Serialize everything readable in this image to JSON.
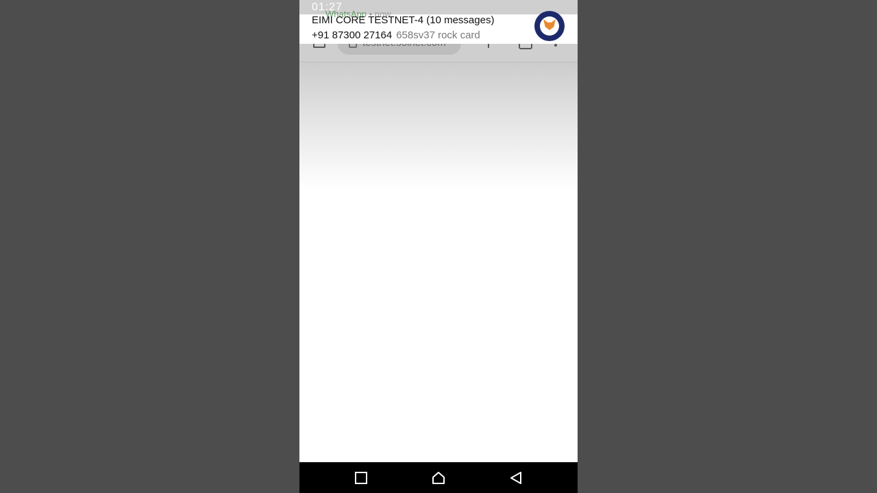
{
  "status_bar": {
    "time": "01:27"
  },
  "browser": {
    "url": "testnet.solnet.com"
  },
  "notification": {
    "app_name": "WhatsApp",
    "time_ago": "now",
    "title": "EIMI CORE TESTNET-4 (10 messages)",
    "sender": "+91 87300 27164",
    "message": "658sv37 rock card",
    "avatar_icon": "metamask-fox-avatar"
  },
  "nav_bar": {
    "recents_icon": "square-icon",
    "home_icon": "home-icon",
    "back_icon": "back-triangle-icon"
  },
  "colors": {
    "backdrop": "#4d4d4d",
    "notification_bg": "#ffffff",
    "nav_bar_bg": "#000000"
  }
}
